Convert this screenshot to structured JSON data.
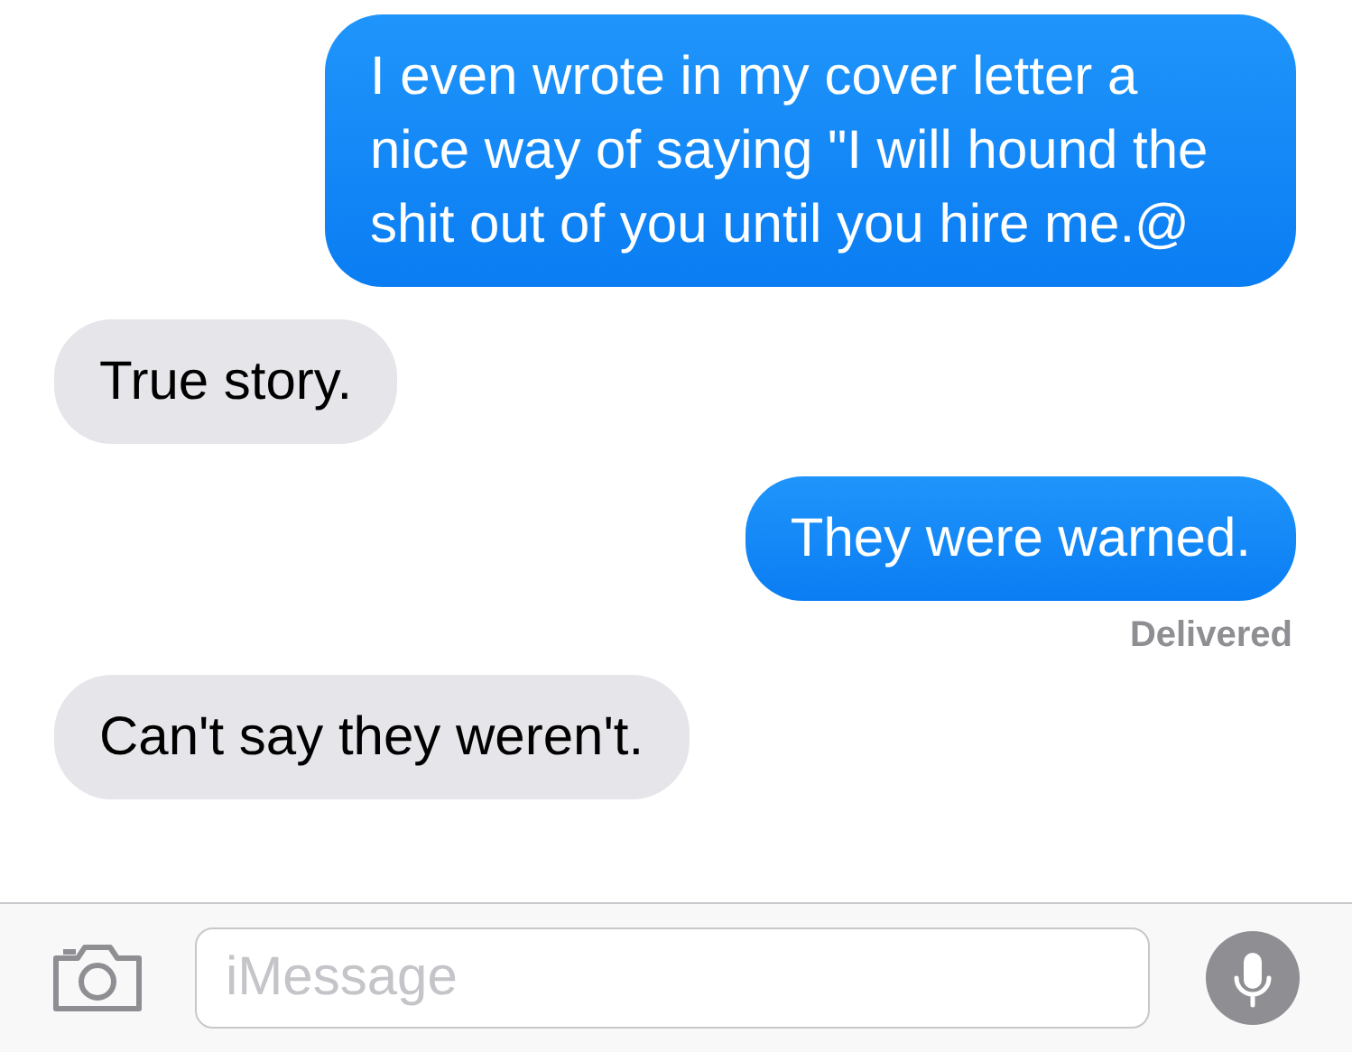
{
  "messages": [
    {
      "kind": "sent",
      "text": "I even wrote in my cover letter a nice way of saying \"I will hound the shit out of you until you hire me.@"
    },
    {
      "kind": "received",
      "text": "True story."
    },
    {
      "kind": "sent",
      "text": "They were warned.",
      "status": "Delivered"
    },
    {
      "kind": "received",
      "text": "Can't say they weren't."
    }
  ],
  "compose": {
    "placeholder": "iMessage"
  }
}
